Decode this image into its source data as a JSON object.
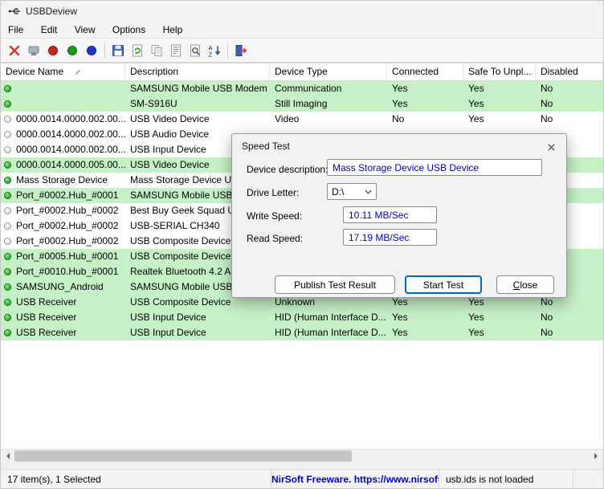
{
  "window": {
    "title": "USBDeview"
  },
  "menubar": {
    "items": [
      "File",
      "Edit",
      "View",
      "Options",
      "Help"
    ]
  },
  "toolbar": {
    "icons": [
      "uninstall-red-x-icon",
      "disconnect-device-icon",
      "disable-red-circle-icon",
      "enable-green-circle-icon",
      "restart-blue-circle-icon",
      "save-floppy-icon",
      "refresh-icon",
      "copy-icon",
      "properties-icon",
      "find-icon",
      "sort-az-icon",
      "exit-icon"
    ]
  },
  "table": {
    "columns": [
      "Device Name",
      "Description",
      "Device Type",
      "Connected",
      "Safe To Unpl...",
      "Disabled"
    ],
    "rows": [
      {
        "dot": "green",
        "green": true,
        "name": "",
        "description": "SAMSUNG Mobile USB Modem",
        "type": "Communication",
        "connected": "Yes",
        "safe": "Yes",
        "disabled": "No"
      },
      {
        "dot": "green",
        "green": true,
        "name": "",
        "description": "SM-S916U",
        "type": "Still Imaging",
        "connected": "Yes",
        "safe": "Yes",
        "disabled": "No"
      },
      {
        "dot": "gray",
        "green": false,
        "name": "0000.0014.0000.002.00...",
        "description": "USB Video Device",
        "type": "Video",
        "connected": "No",
        "safe": "Yes",
        "disabled": "No"
      },
      {
        "dot": "gray",
        "green": false,
        "name": "0000.0014.0000.002.00...",
        "description": "USB Audio Device",
        "type": "",
        "connected": "",
        "safe": "",
        "disabled": ""
      },
      {
        "dot": "gray",
        "green": false,
        "name": "0000.0014.0000.002.00...",
        "description": "USB Input Device",
        "type": "",
        "connected": "",
        "safe": "",
        "disabled": ""
      },
      {
        "dot": "green",
        "green": true,
        "name": "0000.0014.0000.005.00...",
        "description": "USB Video Device",
        "type": "",
        "connected": "",
        "safe": "",
        "disabled": ""
      },
      {
        "dot": "green",
        "green": false,
        "name": "Mass Storage Device",
        "description": "Mass Storage Device USB",
        "type": "",
        "connected": "",
        "safe": "",
        "disabled": ""
      },
      {
        "dot": "green",
        "green": true,
        "name": "Port_#0002.Hub_#0001",
        "description": "SAMSUNG Mobile USB C",
        "type": "",
        "connected": "",
        "safe": "",
        "disabled": ""
      },
      {
        "dot": "gray",
        "green": false,
        "name": "Port_#0002.Hub_#0002",
        "description": "Best Buy Geek Squad U3",
        "type": "",
        "connected": "",
        "safe": "",
        "disabled": ""
      },
      {
        "dot": "gray",
        "green": false,
        "name": "Port_#0002.Hub_#0002",
        "description": "USB-SERIAL CH340",
        "type": "",
        "connected": "",
        "safe": "",
        "disabled": ""
      },
      {
        "dot": "gray",
        "green": false,
        "name": "Port_#0002.Hub_#0002",
        "description": "USB Composite Device",
        "type": "",
        "connected": "",
        "safe": "",
        "disabled": ""
      },
      {
        "dot": "green",
        "green": true,
        "name": "Port_#0005.Hub_#0001",
        "description": "USB Composite Device",
        "type": "",
        "connected": "",
        "safe": "",
        "disabled": ""
      },
      {
        "dot": "green",
        "green": true,
        "name": "Port_#0010.Hub_#0001",
        "description": "Realtek Bluetooth 4.2 Ada",
        "type": "",
        "connected": "",
        "safe": "",
        "disabled": ""
      },
      {
        "dot": "green",
        "green": true,
        "name": "SAMSUNG_Android",
        "description": "SAMSUNG Mobile USB",
        "type": "",
        "connected": "",
        "safe": "",
        "disabled": ""
      },
      {
        "dot": "green",
        "green": true,
        "name": "USB Receiver",
        "description": "USB Composite Device",
        "type": "Unknown",
        "connected": "Yes",
        "safe": "Yes",
        "disabled": "No"
      },
      {
        "dot": "green",
        "green": true,
        "name": "USB Receiver",
        "description": "USB Input Device",
        "type": "HID (Human Interface D...",
        "connected": "Yes",
        "safe": "Yes",
        "disabled": "No"
      },
      {
        "dot": "green",
        "green": true,
        "name": "USB Receiver",
        "description": "USB Input Device",
        "type": "HID (Human Interface D...",
        "connected": "Yes",
        "safe": "Yes",
        "disabled": "No"
      }
    ]
  },
  "dialog": {
    "title": "Speed Test",
    "device_description_label": "Device description:",
    "device_description_value": "Mass Storage Device USB Device",
    "drive_letter_label": "Drive Letter:",
    "drive_letter_value": "D:\\",
    "write_speed_label": "Write Speed:",
    "write_speed_value": "10.11 MB/Sec",
    "read_speed_label": "Read Speed:",
    "read_speed_value": "17.19 MB/Sec",
    "publish_button": "Publish Test Result",
    "start_button": "Start Test",
    "close_button": "Close"
  },
  "statusbar": {
    "items_text": "17 item(s), 1 Selected",
    "nirsoft_text": "NirSoft Freeware.  https://www.nirsoft.net",
    "usbids_text": "usb.ids is not loaded"
  },
  "colors": {
    "row_green": "#c6f0c6",
    "value_blue": "#0000cc",
    "focus_border": "#0067c0"
  }
}
